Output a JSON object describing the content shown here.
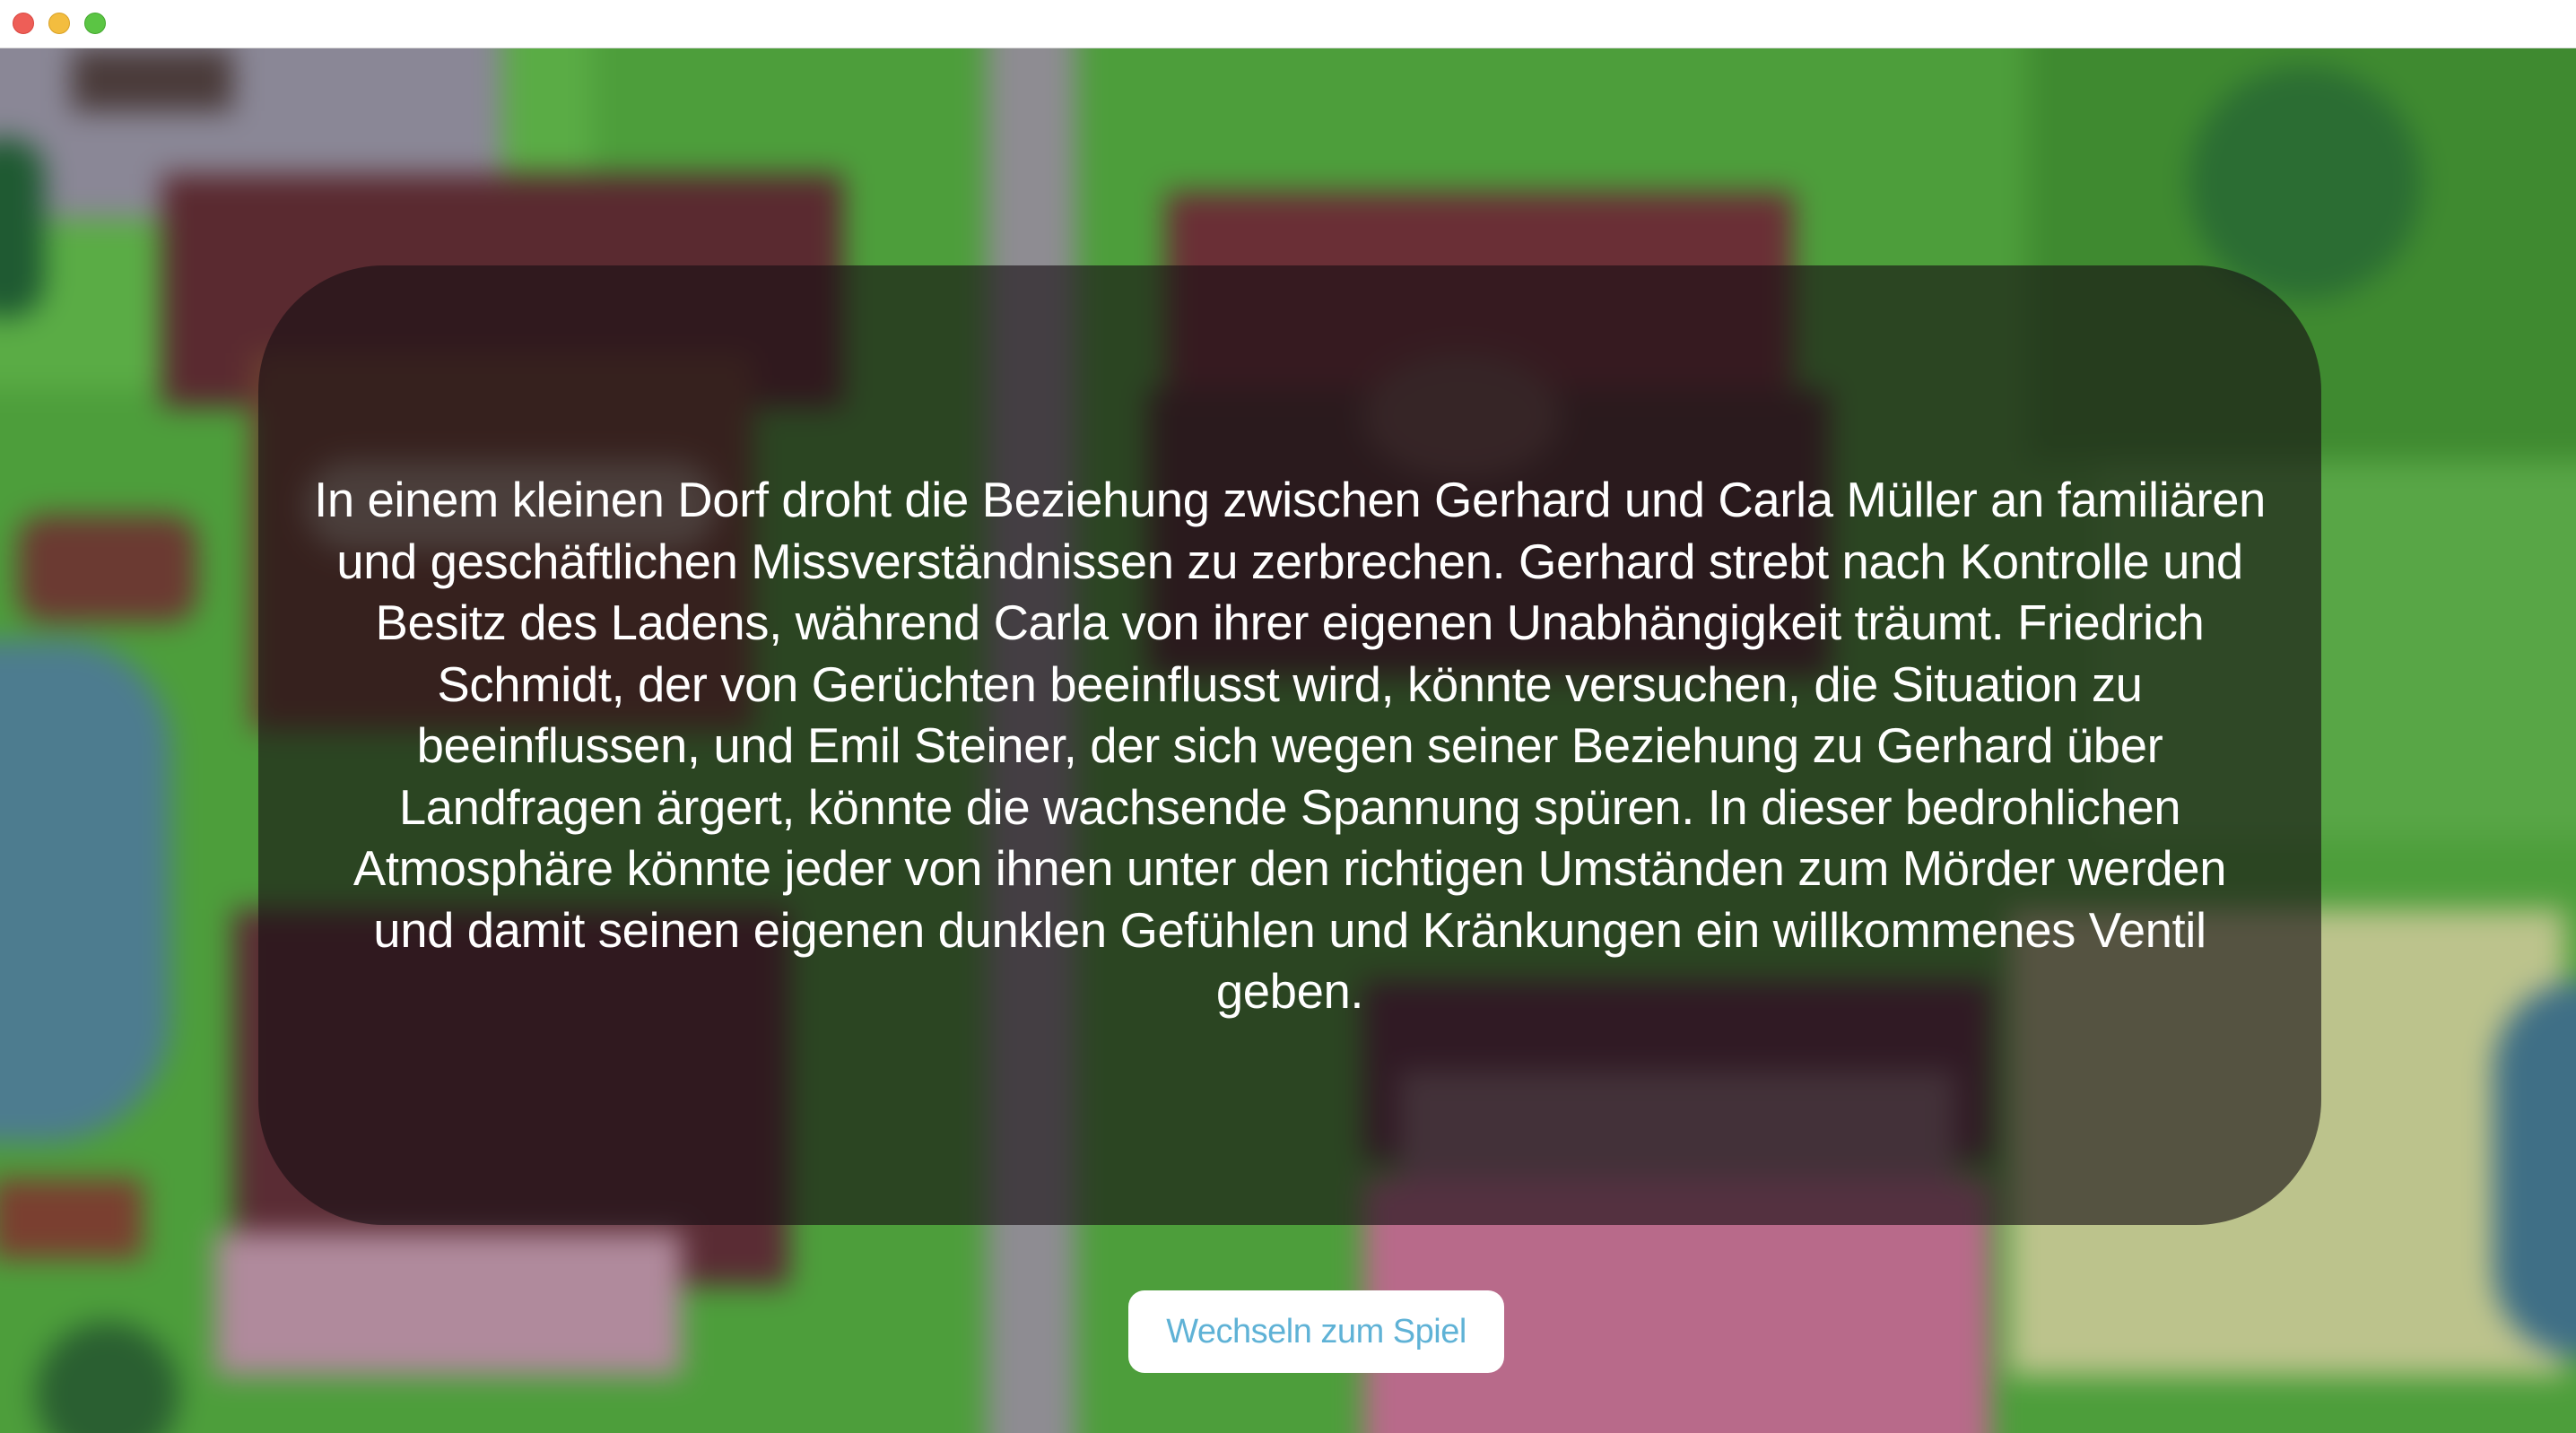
{
  "window": {
    "controls": [
      "close",
      "minimize",
      "zoom"
    ]
  },
  "intro": {
    "story": "In einem kleinen Dorf droht die Beziehung zwischen Gerhard und Carla Müller an familiären und geschäftlichen Missverständnissen zu zerbrechen. Gerhard strebt nach Kontrolle und Besitz des Ladens, während Carla von ihrer eigenen Unabhängigkeit träumt. Friedrich Schmidt, der von Gerüchten beeinflusst wird, könnte versuchen, die Situation zu beeinflussen, und Emil Steiner, der sich wegen seiner Beziehung zu Gerhard über Landfragen ärgert, könnte die wachsende Spannung spüren. In dieser bedrohlichen Atmosphäre könnte jeder von ihnen unter den richtigen Umständen zum Mörder werden und damit seinen eigenen dunklen Gefühlen und Kränkungen ein willkommenes Ventil geben.",
    "button_label": "Wechseln zum Spiel"
  },
  "colors": {
    "close": "#ee5e57",
    "minimize": "#f3bd3f",
    "zoom": "#5bc544",
    "button_text": "#5fb2d6",
    "panel": "rgba(22, 14, 20, 0.62)"
  }
}
